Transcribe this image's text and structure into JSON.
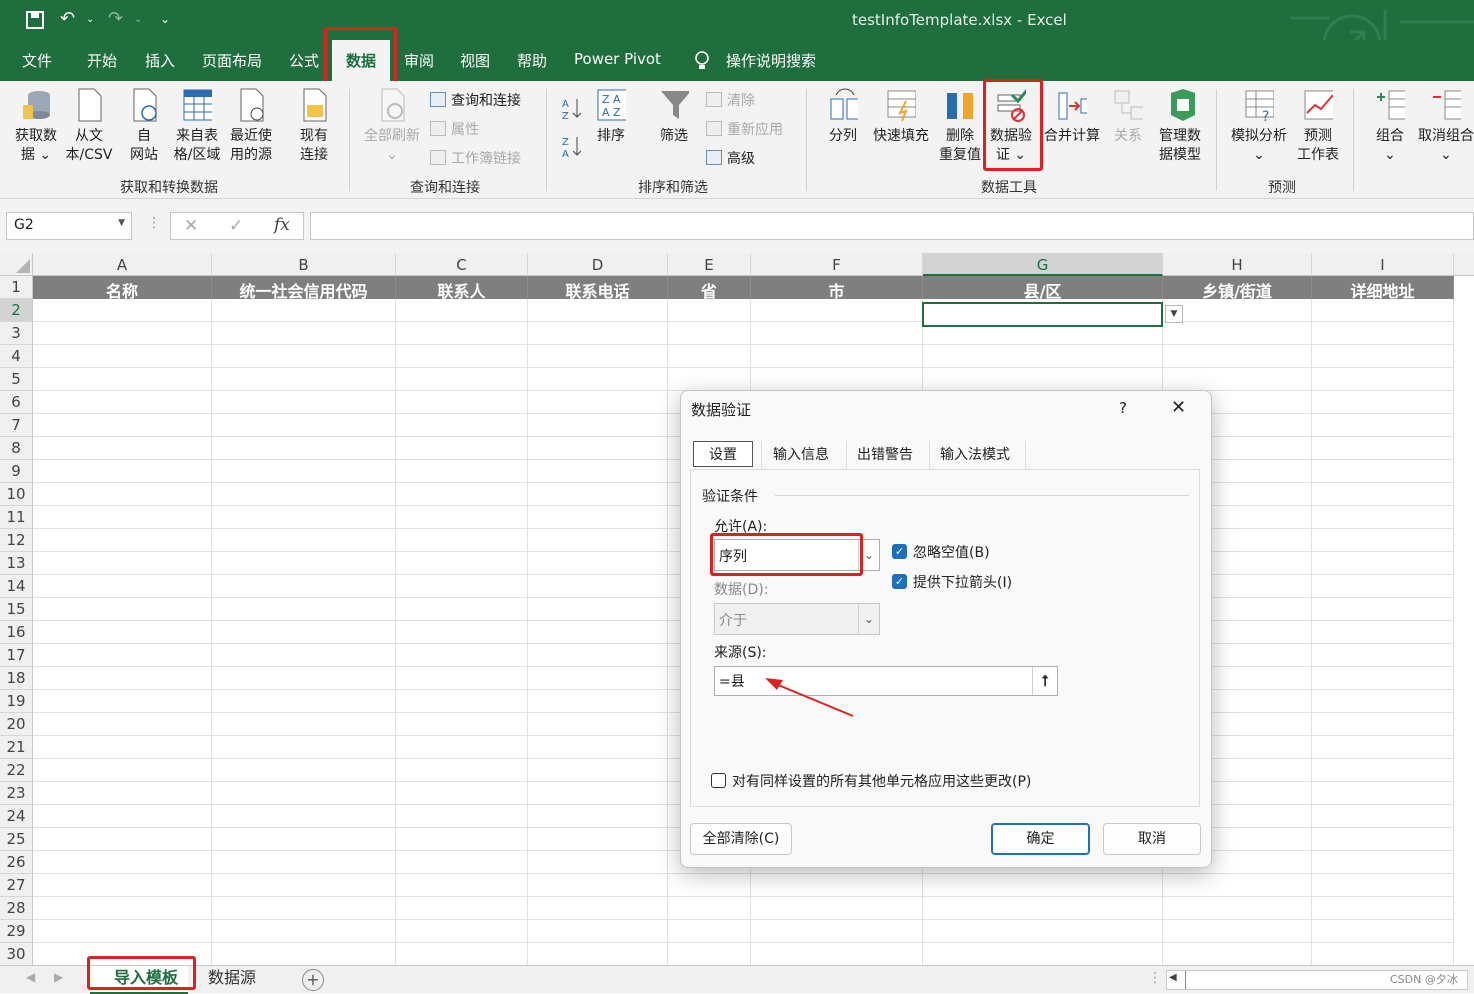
{
  "window": {
    "title": "testInfoTemplate.xlsx  -  Excel"
  },
  "tabs": [
    {
      "label": "文件"
    },
    {
      "label": "开始"
    },
    {
      "label": "插入"
    },
    {
      "label": "页面布局"
    },
    {
      "label": "公式"
    },
    {
      "label": "数据"
    },
    {
      "label": "审阅"
    },
    {
      "label": "视图"
    },
    {
      "label": "帮助"
    },
    {
      "label": "Power Pivot"
    }
  ],
  "search": {
    "label": "操作说明搜索"
  },
  "ribbon": {
    "get_data": "获取数\n据 ⌄",
    "from_csv": "从文\n本/CSV",
    "from_web": "自\n网站",
    "from_table": "来自表\n格/区域",
    "recent_sources": "最近使\n用的源",
    "existing_conn": "现有\n连接",
    "group_get": "获取和转换数据",
    "refresh_all": "全部刷新\n⌄",
    "queries_conn": "查询和连接",
    "properties": "属性",
    "workbook_links": "工作簿链接",
    "group_queries": "查询和连接",
    "sort": "排序",
    "filter": "筛选",
    "clear": "清除",
    "reapply": "重新应用",
    "advanced": "高级",
    "group_sort": "排序和筛选",
    "text_to_cols": "分列",
    "flash_fill": "快速填充",
    "remove_dup": "删除\n重复值",
    "data_validation": "数据验\n证 ⌄",
    "consolidate": "合并计算",
    "relationships": "关系",
    "data_model": "管理数\n据模型",
    "group_tools": "数据工具",
    "what_if": "模拟分析\n⌄",
    "forecast_sheet": "预测\n工作表",
    "group_forecast": "预测",
    "group_btn": "组合\n⌄",
    "ungroup_btn": "取消组合\n⌄"
  },
  "formula_bar": {
    "name_box": "G2",
    "fx": "fx"
  },
  "columns": [
    "A",
    "B",
    "C",
    "D",
    "E",
    "F",
    "G",
    "H",
    "I"
  ],
  "header_row": [
    "名称",
    "统一社会信用代码",
    "联系人",
    "联系电话",
    "省",
    "市",
    "县/区",
    "乡镇/街道",
    "详细地址"
  ],
  "rows": [
    "1",
    "2",
    "3",
    "4",
    "5",
    "6",
    "7",
    "8",
    "9",
    "10",
    "11",
    "12",
    "13",
    "14",
    "15",
    "16",
    "17",
    "18",
    "19",
    "20",
    "21",
    "22",
    "23",
    "24",
    "25",
    "26",
    "27",
    "28",
    "29",
    "30"
  ],
  "dialog": {
    "title": "数据验证",
    "help": "?",
    "close": "✕",
    "tabs": [
      "设置",
      "输入信息",
      "出错警告",
      "输入法模式"
    ],
    "section": "验证条件",
    "allow_label": "允许(A):",
    "allow_value": "序列",
    "ignore_blank": "忽略空值(B)",
    "dropdown_arrow": "提供下拉箭头(I)",
    "data_label": "数据(D):",
    "data_value": "介于",
    "source_label": "来源(S):",
    "source_value": "=县",
    "apply_all": "对有同样设置的所有其他单元格应用这些更改(P)",
    "clear_all": "全部清除(C)",
    "ok": "确定",
    "cancel": "取消"
  },
  "sheets": [
    {
      "label": "导入模板"
    },
    {
      "label": "数据源"
    }
  ],
  "watermark": "CSDN @夕冰",
  "colors": {
    "excel_green": "#1e6e3e",
    "highlight_red": "#e02020"
  }
}
